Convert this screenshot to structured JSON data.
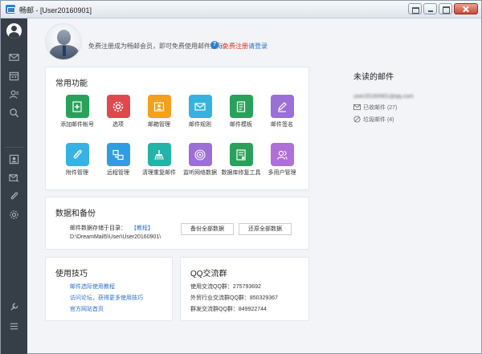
{
  "window": {
    "title": "畅邮 - [User20160901]"
  },
  "header": {
    "notice": "免费注册成为畅邮会员，即可免费使用邮件选际。",
    "register": "免费注册",
    "login": "请登录"
  },
  "functions": {
    "title": "常用功能",
    "tiles": [
      {
        "label": "添加邮件帐号",
        "icon": "add-account-icon",
        "color": "#2aa15a"
      },
      {
        "label": "选项",
        "icon": "gear-icon",
        "color": "#e0484e"
      },
      {
        "label": "邮箱管理",
        "icon": "mailbox-manage-icon",
        "color": "#f2a01e"
      },
      {
        "label": "邮件规则",
        "icon": "mail-rule-icon",
        "color": "#35b3de"
      },
      {
        "label": "邮件模板",
        "icon": "template-icon",
        "color": "#2aa15a"
      },
      {
        "label": "邮件签名",
        "icon": "pen-icon",
        "color": "#9b6fd6"
      },
      {
        "label": "附件管理",
        "icon": "paperclip-icon",
        "color": "#37b2e4"
      },
      {
        "label": "远程管理",
        "icon": "remote-icon",
        "color": "#2f9ee0"
      },
      {
        "label": "清理重复邮件",
        "icon": "broom-icon",
        "color": "#23b3a8"
      },
      {
        "label": "监听网络数据",
        "icon": "radar-icon",
        "color": "#9b6fd6"
      },
      {
        "label": "数据库修复工具",
        "icon": "database-repair-icon",
        "color": "#2aa15a"
      },
      {
        "label": "多用户管理",
        "icon": "users-icon",
        "color": "#b06fd6"
      }
    ]
  },
  "backup": {
    "title": "数据和备份",
    "store_label": "邮件数据存储于目录：",
    "tutorial": "【教程】",
    "path": "D:\\DreamMail5\\User\\User20160901\\",
    "backup_all": "备份全部数据",
    "restore_all": "还原全部数据"
  },
  "tips": {
    "title": "使用技巧",
    "links": [
      "邮件选际使用教程",
      "访问论坛，获得更多使用技巧",
      "官方网站首页"
    ]
  },
  "qq": {
    "title": "QQ交流群",
    "lines": [
      "使用交流QQ群：275793692",
      "外贸行业交流群QQ群：850329367",
      "群发交流群QQ群：849922744"
    ]
  },
  "unread": {
    "title": "未读的邮件",
    "email": "user20160901@qq.com",
    "folders": [
      {
        "label": "已收邮件 (27)",
        "icon": "inbox-icon"
      },
      {
        "label": "垃圾邮件 (4)",
        "icon": "spam-icon"
      }
    ]
  },
  "sidebar": {
    "items": [
      "user-avatar-icon",
      "mail-icon",
      "calendar-icon",
      "contacts-icon",
      "search-icon",
      "contact-card-icon",
      "send-mail-icon",
      "attachment-icon",
      "settings-icon",
      "tools-icon",
      "menu-icon"
    ]
  },
  "colors": {
    "sidebar_bg": "#363e48",
    "link": "#2a6fc9",
    "register": "#e0341e"
  }
}
